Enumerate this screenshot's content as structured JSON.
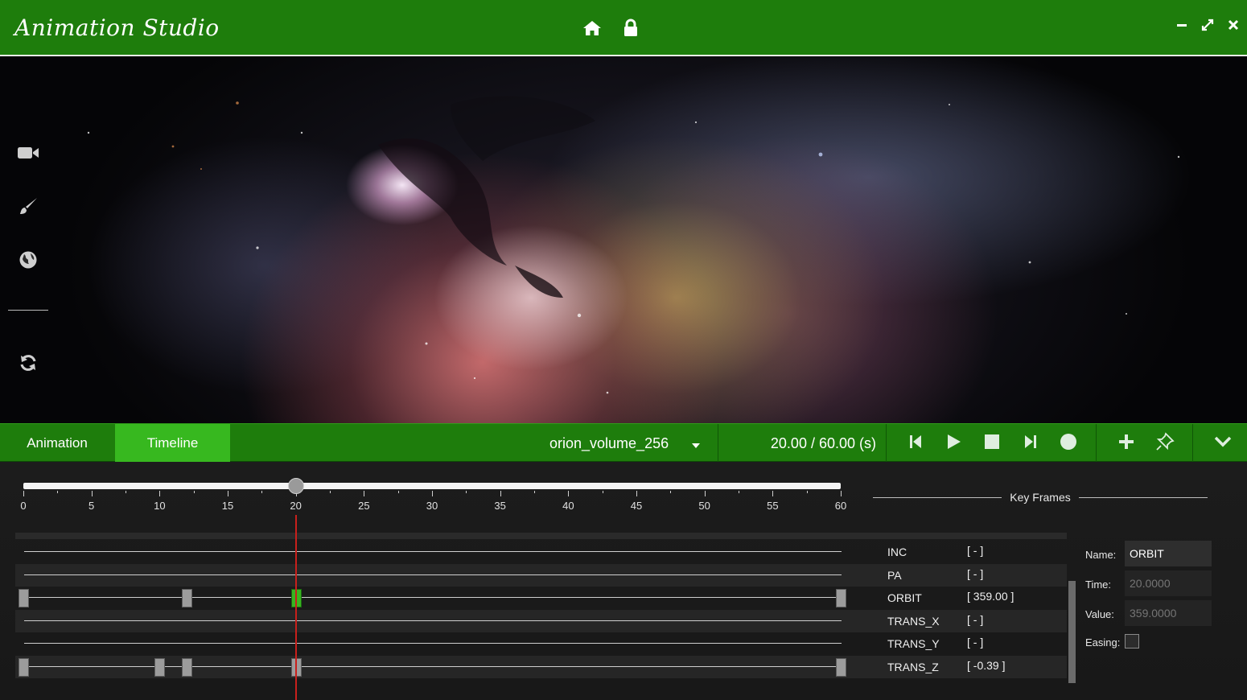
{
  "app": {
    "title": "Animation Studio"
  },
  "window_buttons": {
    "minimize": "minimize-icon",
    "maximize": "maximize-icon",
    "close": "close-icon"
  },
  "header_icons": [
    "home-icon",
    "lock-icon"
  ],
  "sidebar": {
    "items": [
      "video-camera-icon",
      "paint-brush-icon",
      "globe-icon",
      "refresh-icon"
    ]
  },
  "tabs": [
    {
      "label": "Animation",
      "active": false
    },
    {
      "label": "Timeline",
      "active": true
    }
  ],
  "dataset": {
    "selected": "orion_volume_256"
  },
  "time": {
    "current": 20,
    "total": 60,
    "display": "20.00 / 60.00 (s)"
  },
  "transport": [
    "skip-back-icon",
    "play-icon",
    "stop-icon",
    "skip-forward-icon",
    "record-icon",
    "add-icon",
    "pin-icon",
    "collapse-icon"
  ],
  "timeline": {
    "range": [
      0,
      60
    ],
    "current": 20,
    "tick_labels": [
      "0",
      "5",
      "10",
      "15",
      "20",
      "25",
      "30",
      "35",
      "40",
      "45",
      "50",
      "55",
      "60"
    ]
  },
  "keyframes_panel": {
    "title": "Key Frames"
  },
  "tracks": [
    {
      "name": "INC",
      "value": "[ - ]",
      "keys": []
    },
    {
      "name": "PA",
      "value": "[ - ]",
      "keys": []
    },
    {
      "name": "ORBIT",
      "value": "[ 359.00 ]",
      "keys": [
        0,
        12,
        20,
        60
      ],
      "active_key": 20
    },
    {
      "name": "TRANS_X",
      "value": "[ - ]",
      "keys": []
    },
    {
      "name": "TRANS_Y",
      "value": "[ - ]",
      "keys": []
    },
    {
      "name": "TRANS_Z",
      "value": "[ -0.39 ]",
      "keys": [
        0,
        10,
        12,
        20,
        60
      ]
    }
  ],
  "properties": {
    "name_label": "Name:",
    "name_value": "ORBIT",
    "time_label": "Time:",
    "time_placeholder": "20.0000",
    "value_label": "Value:",
    "value_placeholder": "359.0000",
    "easing_label": "Easing:",
    "easing": false
  },
  "colors": {
    "brand": "#1e7d0c",
    "active_tab": "#37b81f",
    "playhead": "#c8201c"
  }
}
